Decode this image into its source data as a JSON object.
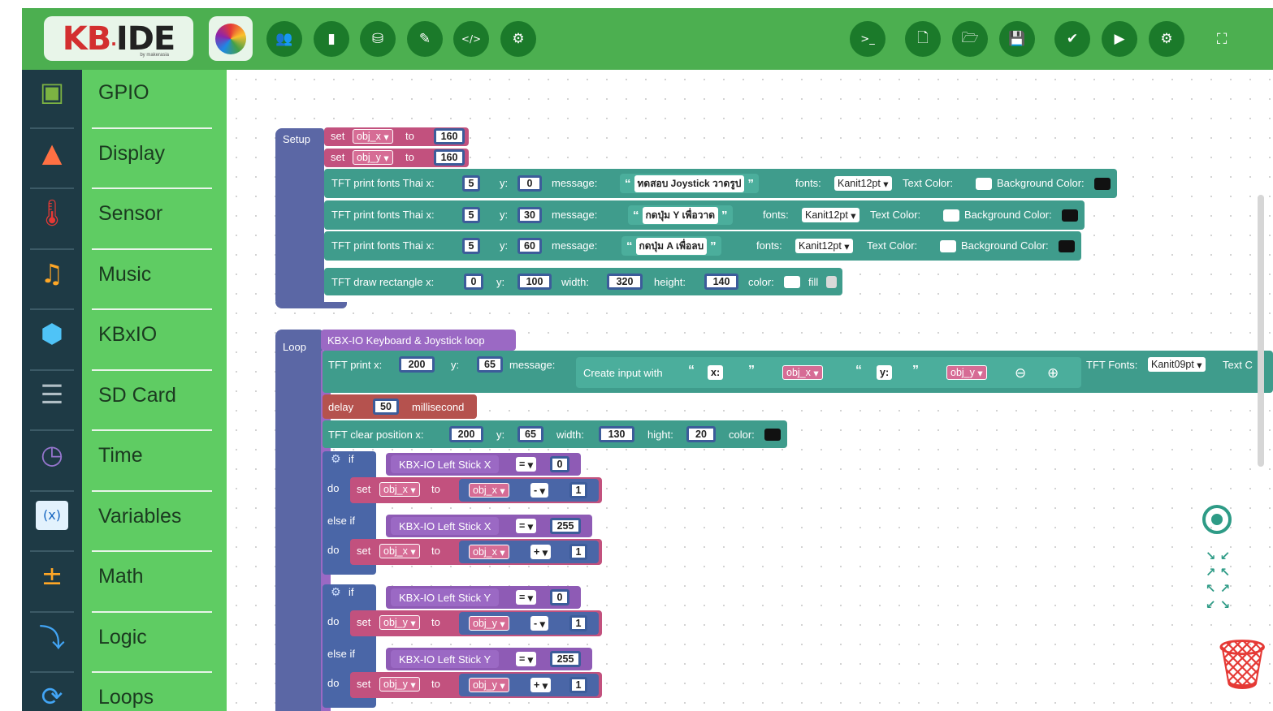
{
  "app": {
    "logo": "KB·IDE",
    "logo_ide": "IDE",
    "logo_prefix": "KB",
    "logo_sub": "by makerasia"
  },
  "toolbar": {
    "left": [
      {
        "name": "boards-button",
        "glyph": "👥"
      },
      {
        "name": "board-button",
        "glyph": "▮"
      },
      {
        "name": "plugins-button",
        "glyph": "⛁"
      },
      {
        "name": "tools-button",
        "glyph": "✎"
      },
      {
        "name": "code-button",
        "glyph": "</>"
      },
      {
        "name": "settings-button",
        "glyph": "⚙"
      }
    ],
    "right": [
      {
        "name": "terminal-button",
        "glyph": ">_"
      },
      {
        "name": "new-file-button",
        "glyph": "🗋"
      },
      {
        "name": "open-folder-button",
        "glyph": "🗁"
      },
      {
        "name": "save-button",
        "glyph": "💾"
      },
      {
        "name": "compile-button",
        "glyph": "✔"
      },
      {
        "name": "run-button",
        "glyph": "▶"
      },
      {
        "name": "board-settings-button",
        "glyph": "⚙"
      },
      {
        "name": "fullscreen-button",
        "glyph": "⛶"
      }
    ]
  },
  "sidebar": {
    "items": [
      {
        "label": "GPIO",
        "icon": "chip-icon",
        "glyph": "▣",
        "color": "#7cb342"
      },
      {
        "label": "Display",
        "icon": "image-icon",
        "glyph": "▲",
        "color": "#ff7043"
      },
      {
        "label": "Sensor",
        "icon": "thermometer-icon",
        "glyph": "🌡",
        "color": "#e53935"
      },
      {
        "label": "Music",
        "icon": "music-icon",
        "glyph": "♫",
        "color": "#ffa726"
      },
      {
        "label": "KBxIO",
        "icon": "cube-icon",
        "glyph": "⬢",
        "color": "#4fc3f7"
      },
      {
        "label": "SD Card",
        "icon": "storage-icon",
        "glyph": "☰",
        "color": "#b0bec5"
      },
      {
        "label": "Time",
        "icon": "clock-icon",
        "glyph": "◷",
        "color": "#9575cd"
      },
      {
        "label": "Variables",
        "icon": "variable-icon",
        "glyph": "(x)",
        "color": "#64b5f6"
      },
      {
        "label": "Math",
        "icon": "math-icon",
        "glyph": "±",
        "color": "#ffa726"
      },
      {
        "label": "Logic",
        "icon": "logic-icon",
        "glyph": "⤵",
        "color": "#42a5f5"
      },
      {
        "label": "Loops",
        "icon": "loop-icon",
        "glyph": "⟳",
        "color": "#42a5f5"
      }
    ]
  },
  "blocks": {
    "setup": {
      "label": "Setup",
      "set_x": {
        "set": "set",
        "var": "obj_x",
        "to": "to",
        "value": "160"
      },
      "set_y": {
        "set": "set",
        "var": "obj_y",
        "to": "to",
        "value": "160"
      },
      "prints": [
        {
          "label": "TFT print fonts Thai x:",
          "x": "5",
          "y_label": "y:",
          "y": "0",
          "msg_label": "message:",
          "msg": "ทดสอบ Joystick วาดรูป",
          "fonts_label": "fonts:",
          "font": "Kanit12pt",
          "tc_label": "Text Color:",
          "bg_label": "Background Color:"
        },
        {
          "label": "TFT print fonts Thai x:",
          "x": "5",
          "y_label": "y:",
          "y": "30",
          "msg_label": "message:",
          "msg": "กดปุ่ม Y เพื่อวาด",
          "fonts_label": "fonts:",
          "font": "Kanit12pt",
          "tc_label": "Text Color:",
          "bg_label": "Background Color:"
        },
        {
          "label": "TFT print fonts Thai x:",
          "x": "5",
          "y_label": "y:",
          "y": "60",
          "msg_label": "message:",
          "msg": "กดปุ่ม A เพื่อลบ",
          "fonts_label": "fonts:",
          "font": "Kanit12pt",
          "tc_label": "Text Color:",
          "bg_label": "Background Color:"
        }
      ],
      "rect": {
        "label": "TFT draw rectangle x:",
        "x": "0",
        "y_label": "y:",
        "y": "100",
        "w_label": "width:",
        "w": "320",
        "h_label": "height:",
        "h": "140",
        "color_label": "color:",
        "fill_label": "fill"
      }
    },
    "loop": {
      "label": "Loop",
      "kbx": "KBX-IO Keyboard & Joystick loop",
      "print": {
        "label": "TFT print x:",
        "x": "200",
        "y_label": "y:",
        "y": "65",
        "msg_label": "message:",
        "create": "Create input with",
        "s1": "x:",
        "v1": "obj_x",
        "s2": "y:",
        "v2": "obj_y",
        "fonts_label": "TFT Fonts:",
        "font": "Kanit09pt",
        "tc_label": "Text C"
      },
      "delay": {
        "label": "delay",
        "value": "50",
        "unit": "millisecond"
      },
      "clear": {
        "label": "TFT clear position x:",
        "x": "200",
        "y_label": "y:",
        "y": "65",
        "w_label": "width:",
        "w": "130",
        "h_label": "hight:",
        "h": "20",
        "color_label": "color:"
      },
      "if_kw": "if",
      "do_kw": "do",
      "elseif_kw": "else if",
      "set_kw": "set",
      "to_kw": "to",
      "cond1": {
        "stick": "KBX-IO Left Stick X",
        "op": "=",
        "value": "0",
        "var": "obj_x",
        "math": "-",
        "n": "1"
      },
      "cond2": {
        "stick": "KBX-IO Left Stick X",
        "op": "=",
        "value": "255",
        "var": "obj_x",
        "math": "+",
        "n": "1"
      },
      "cond3": {
        "stick": "KBX-IO Left Stick Y",
        "op": "=",
        "value": "0",
        "var": "obj_y",
        "math": "-",
        "n": "1"
      },
      "cond4": {
        "stick": "KBX-IO Left Stick Y",
        "op": "=",
        "value": "255",
        "var": "obj_y",
        "math": "+",
        "n": "1"
      }
    }
  },
  "tools": {
    "target_icon": "recenter-icon",
    "zoom_icon": "zoom-fit-icon",
    "trash_icon": "trash-icon",
    "zoom_glyph": "↘↙↗↖↖↗↙↘"
  }
}
